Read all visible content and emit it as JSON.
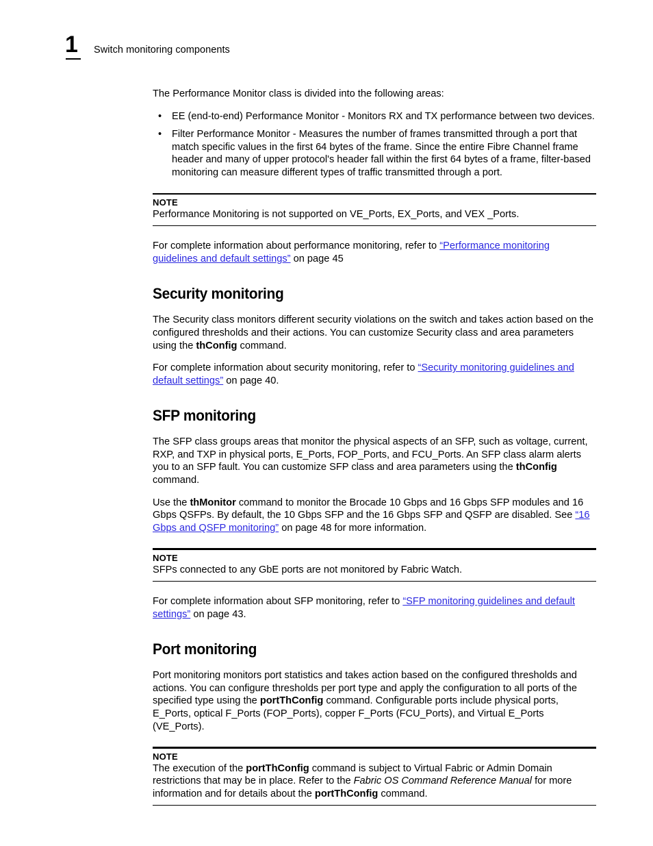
{
  "header": {
    "chapter_number": "1",
    "title": "Switch monitoring components"
  },
  "colors": {
    "link": "#2b28e0",
    "text": "#000000",
    "background": "#ffffff"
  },
  "content": {
    "intro_paragraph": "The Performance Monitor class is divided into the following areas:",
    "bullets": [
      {
        "marker": "•",
        "text": "EE (end-to-end) Performance Monitor - Monitors RX and TX performance between two devices."
      },
      {
        "marker": "•",
        "text": "Filter Performance Monitor - Measures the number of frames transmitted through a port that match specific values in the first 64 bytes of the frame. Since the entire Fibre Channel frame header and many of upper protocol's header fall within the first 64 bytes of a frame, filter-based monitoring can measure different types of traffic transmitted through a port."
      }
    ],
    "note_1": {
      "label": "NOTE",
      "body": "Performance Monitoring is not supported on VE_Ports, EX_Ports, and VEX _Ports."
    },
    "performance_ref": {
      "lead": "For complete information about performance monitoring, refer to ",
      "link": "“Performance monitoring guidelines and default settings”",
      "tail": " on page 45"
    },
    "security_section": {
      "heading": "Security monitoring",
      "para_1_part1": "The Security class monitors different security violations on the switch and takes action based on the configured thresholds and their actions. You can customize Security class and area parameters using the ",
      "para_1_cmd": "thConfig",
      "para_1_part2": " command.",
      "ref_lead": "For complete information about security monitoring, refer to ",
      "ref_link": "“Security monitoring guidelines and default settings”",
      "ref_tail": " on page 40."
    },
    "sfp_section": {
      "heading": "SFP monitoring",
      "para_1_part1": "The SFP class groups areas that monitor the physical aspects of an SFP, such as voltage, current, RXP, and TXP in physical ports, E_Ports, FOP_Ports, and FCU_Ports. An SFP class alarm alerts you to an SFP fault. You can customize SFP class and area parameters using the ",
      "para_1_cmd": "thConfig",
      "para_1_part2": " command.",
      "para_2_part1": "Use the ",
      "para_2_cmd": "thMonitor",
      "para_2_part2": " command to monitor the Brocade 10 Gbps and 16 Gbps SFP modules and 16 Gbps QSFPs. By default, the 10 Gbps SFP and the 16 Gbps SFP and QSFP are disabled. See ",
      "para_2_link": "“16 Gbps and QSFP monitoring”",
      "para_2_part3": " on page 48 for more information.",
      "note": {
        "label": "NOTE",
        "body": "SFPs connected to any GbE ports are not monitored by Fabric Watch."
      },
      "ref_lead": "For complete information about SFP monitoring, refer to ",
      "ref_link": "“SFP monitoring guidelines and default settings”",
      "ref_tail": " on page 43."
    },
    "port_section": {
      "heading": "Port monitoring",
      "para_1_part1": "Port monitoring monitors port statistics and takes action based on the configured thresholds and actions. You can configure thresholds per port type and apply the configuration to all ports of the specified type using the ",
      "para_1_cmd": "portThConfig",
      "para_1_part2": " command. Configurable ports include physical ports, E_Ports, optical F_Ports (FOP_Ports), copper F_Ports (FCU_Ports), and Virtual E_Ports (VE_Ports).",
      "note": {
        "label": "NOTE",
        "part1": "The execution of the ",
        "cmd1": "portThConfig",
        "part2": " command is subject to Virtual Fabric or Admin Domain restrictions that may be in place. Refer to the ",
        "italic": "Fabric OS Command Reference Manual",
        "part3": " for more information and for details about the ",
        "cmd2": "portThConfig",
        "part4": " command."
      }
    }
  }
}
